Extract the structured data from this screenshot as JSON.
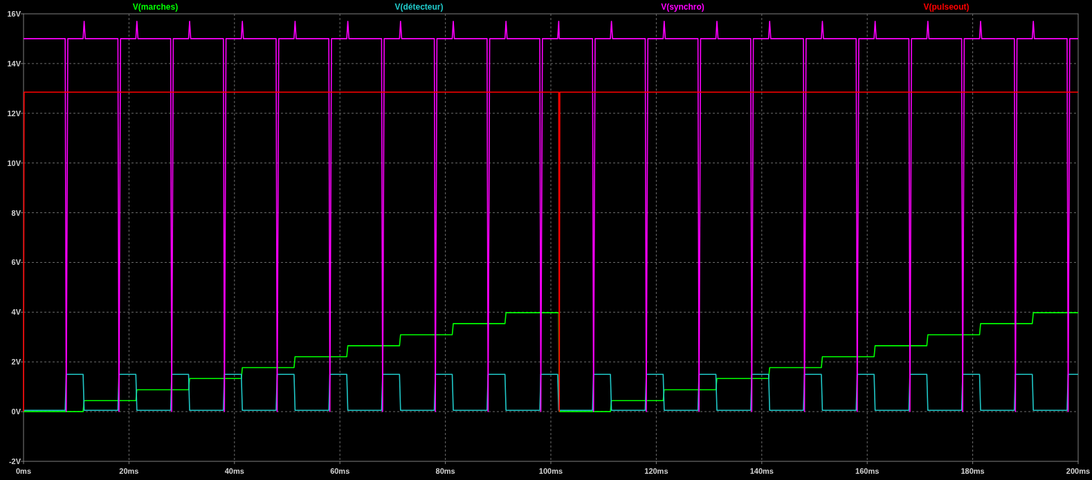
{
  "plot": {
    "chart_data": {
      "type": "line",
      "grid": true,
      "x": [
        0,
        0.1,
        1.3,
        1.5,
        1.7,
        7.9,
        8.1,
        8.4,
        10,
        11.3,
        11.5,
        11.7,
        17.9,
        18.1,
        18.4,
        20,
        21.3,
        21.5,
        21.7,
        27.9,
        28.1,
        28.4,
        30,
        31.3,
        31.5,
        31.7,
        37.9,
        38.1,
        38.4,
        40,
        41.3,
        41.5,
        41.7,
        47.9,
        48.1,
        48.4,
        50,
        51.3,
        51.5,
        51.7,
        57.9,
        58.1,
        58.4,
        60,
        61.3,
        61.5,
        61.7,
        67.9,
        68.1,
        68.4,
        70,
        71.3,
        71.5,
        71.7,
        77.9,
        78.1,
        78.4,
        80,
        81.3,
        81.5,
        81.7,
        87.9,
        88.1,
        88.4,
        90,
        91.3,
        91.5,
        91.7,
        97.9,
        98.1,
        98.4,
        100,
        101.3,
        101.5,
        101.6,
        101.7,
        107.9,
        108.1,
        108.4,
        110,
        111.3,
        111.5,
        111.7,
        117.9,
        118.1,
        118.4,
        120,
        121.3,
        121.5,
        121.7,
        127.9,
        128.1,
        128.4,
        130,
        131.3,
        131.5,
        131.7,
        137.9,
        138.1,
        138.4,
        140,
        141.3,
        141.5,
        141.7,
        147.9,
        148.1,
        148.4,
        150,
        151.3,
        151.5,
        151.7,
        157.9,
        158.1,
        158.4,
        160,
        161.3,
        161.5,
        161.7,
        167.9,
        168.1,
        168.4,
        170,
        171.3,
        171.5,
        171.7,
        177.9,
        178.1,
        178.4,
        180,
        181.3,
        181.5,
        181.7,
        187.9,
        188.1,
        188.4,
        190,
        191.3,
        191.5,
        191.7,
        197.9,
        198.1,
        198.4,
        200
      ],
      "series": [
        {
          "name": "V(marches)",
          "color": "#00ff00",
          "values": [
            0,
            0,
            0,
            0,
            0,
            0,
            0,
            0,
            0,
            0,
            0.44,
            0.44,
            0.44,
            0.44,
            0.44,
            0.44,
            0.44,
            0.88,
            0.88,
            0.88,
            0.88,
            0.88,
            0.88,
            0.88,
            1.33,
            1.33,
            1.33,
            1.33,
            1.33,
            1.33,
            1.33,
            1.77,
            1.77,
            1.77,
            1.77,
            1.77,
            1.77,
            1.77,
            2.21,
            2.21,
            2.21,
            2.21,
            2.21,
            2.21,
            2.21,
            2.65,
            2.65,
            2.65,
            2.65,
            2.65,
            2.65,
            2.65,
            3.09,
            3.09,
            3.09,
            3.09,
            3.09,
            3.09,
            3.09,
            3.54,
            3.54,
            3.54,
            3.54,
            3.54,
            3.54,
            3.54,
            3.98,
            3.98,
            3.98,
            3.98,
            3.98,
            3.98,
            3.98,
            3.98,
            0,
            0,
            0,
            0,
            0,
            0,
            0,
            0.44,
            0.44,
            0.44,
            0.44,
            0.44,
            0.44,
            0.44,
            0.88,
            0.88,
            0.88,
            0.88,
            0.88,
            0.88,
            0.88,
            1.33,
            1.33,
            1.33,
            1.33,
            1.33,
            1.33,
            1.33,
            1.77,
            1.77,
            1.77,
            1.77,
            1.77,
            1.77,
            1.77,
            2.21,
            2.21,
            2.21,
            2.21,
            2.21,
            2.21,
            2.21,
            2.65,
            2.65,
            2.65,
            2.65,
            2.65,
            2.65,
            2.65,
            3.09,
            3.09,
            3.09,
            3.09,
            3.09,
            3.09,
            3.09,
            3.54,
            3.54,
            3.54,
            3.54,
            3.54,
            3.54,
            3.54,
            3.98,
            3.98,
            3.98,
            3.98,
            3.98,
            3.98
          ]
        },
        {
          "name": "V(détecteur)",
          "color": "#20c8c8",
          "values": [
            0.05,
            0.05,
            0.05,
            0.05,
            0.05,
            0.05,
            1.5,
            1.5,
            1.5,
            1.5,
            0.05,
            0.05,
            0.05,
            1.5,
            1.5,
            1.5,
            1.5,
            0.05,
            0.05,
            0.05,
            1.5,
            1.5,
            1.5,
            1.5,
            0.05,
            0.05,
            0.05,
            1.5,
            1.5,
            1.5,
            1.5,
            0.05,
            0.05,
            0.05,
            1.5,
            1.5,
            1.5,
            1.5,
            0.05,
            0.05,
            0.05,
            1.5,
            1.5,
            1.5,
            1.5,
            0.05,
            0.05,
            0.05,
            1.5,
            1.5,
            1.5,
            1.5,
            0.05,
            0.05,
            0.05,
            1.5,
            1.5,
            1.5,
            1.5,
            0.05,
            0.05,
            0.05,
            1.5,
            1.5,
            1.5,
            1.5,
            0.05,
            0.05,
            0.05,
            1.5,
            1.5,
            1.5,
            1.5,
            0.05,
            0.05,
            0.05,
            0.05,
            1.5,
            1.5,
            1.5,
            1.5,
            0.05,
            0.05,
            0.05,
            1.5,
            1.5,
            1.5,
            1.5,
            0.05,
            0.05,
            0.05,
            1.5,
            1.5,
            1.5,
            1.5,
            0.05,
            0.05,
            0.05,
            1.5,
            1.5,
            1.5,
            1.5,
            0.05,
            0.05,
            0.05,
            1.5,
            1.5,
            1.5,
            1.5,
            0.05,
            0.05,
            0.05,
            1.5,
            1.5,
            1.5,
            1.5,
            0.05,
            0.05,
            0.05,
            1.5,
            1.5,
            1.5,
            1.5,
            0.05,
            0.05,
            0.05,
            1.5,
            1.5,
            1.5,
            1.5,
            0.05,
            0.05,
            0.05,
            1.5,
            1.5,
            1.5,
            1.5,
            0.05,
            0.05,
            0.05,
            1.5,
            1.5,
            1.5
          ]
        },
        {
          "name": "V(synchro)",
          "color": "#ff00ff",
          "values": [
            15,
            15,
            15,
            15,
            15,
            15,
            0,
            15,
            15,
            15,
            15.7,
            15,
            15,
            0,
            15,
            15,
            15,
            15.7,
            15,
            15,
            0,
            15,
            15,
            15,
            15.7,
            15,
            15,
            0,
            15,
            15,
            15,
            15.7,
            15,
            15,
            0,
            15,
            15,
            15,
            15.7,
            15,
            15,
            0,
            15,
            15,
            15,
            15.7,
            15,
            15,
            0,
            15,
            15,
            15,
            15.7,
            15,
            15,
            0,
            15,
            15,
            15,
            15.7,
            15,
            15,
            0,
            15,
            15,
            15,
            15.7,
            15,
            15,
            0,
            15,
            15,
            15,
            15.7,
            15,
            15,
            15,
            0,
            15,
            15,
            15,
            15.7,
            15,
            15,
            0,
            15,
            15,
            15,
            15.7,
            15,
            15,
            0,
            15,
            15,
            15,
            15.7,
            15,
            15,
            0,
            15,
            15,
            15,
            15.7,
            15,
            15,
            0,
            15,
            15,
            15,
            15.7,
            15,
            15,
            0,
            15,
            15,
            15,
            15.7,
            15,
            15,
            0,
            15,
            15,
            15,
            15.7,
            15,
            15,
            0,
            15,
            15,
            15,
            15.7,
            15,
            15,
            0,
            15,
            15,
            15,
            15.7,
            15,
            15,
            0,
            15,
            15
          ]
        },
        {
          "name": "V(pulseout)",
          "color": "#ff0000",
          "values": [
            0,
            12.85,
            12.85,
            12.85,
            12.85,
            12.85,
            12.85,
            12.85,
            12.85,
            12.85,
            12.85,
            12.85,
            12.85,
            12.85,
            12.85,
            12.85,
            12.85,
            12.85,
            12.85,
            12.85,
            12.85,
            12.85,
            12.85,
            12.85,
            12.85,
            12.85,
            12.85,
            12.85,
            12.85,
            12.85,
            12.85,
            12.85,
            12.85,
            12.85,
            12.85,
            12.85,
            12.85,
            12.85,
            12.85,
            12.85,
            12.85,
            12.85,
            12.85,
            12.85,
            12.85,
            12.85,
            12.85,
            12.85,
            12.85,
            12.85,
            12.85,
            12.85,
            12.85,
            12.85,
            12.85,
            12.85,
            12.85,
            12.85,
            12.85,
            12.85,
            12.85,
            12.85,
            12.85,
            12.85,
            12.85,
            12.85,
            12.85,
            12.85,
            12.85,
            12.85,
            12.85,
            12.85,
            12.85,
            12.85,
            0,
            12.85,
            12.85,
            12.85,
            12.85,
            12.85,
            12.85,
            12.85,
            12.85,
            12.85,
            12.85,
            12.85,
            12.85,
            12.85,
            12.85,
            12.85,
            12.85,
            12.85,
            12.85,
            12.85,
            12.85,
            12.85,
            12.85,
            12.85,
            12.85,
            12.85,
            12.85,
            12.85,
            12.85,
            12.85,
            12.85,
            12.85,
            12.85,
            12.85,
            12.85,
            12.85,
            12.85,
            12.85,
            12.85,
            12.85,
            12.85,
            12.85,
            12.85,
            12.85,
            12.85,
            12.85,
            12.85,
            12.85,
            12.85,
            12.85,
            12.85,
            12.85,
            12.85,
            12.85,
            12.85,
            12.85,
            12.85,
            12.85,
            12.85,
            12.85,
            12.85,
            12.85,
            12.85,
            12.85,
            12.85,
            12.85,
            12.85,
            12.85,
            12.85
          ]
        }
      ],
      "xlim": [
        0,
        200
      ],
      "ylim": [
        -2,
        16
      ],
      "xticks": [
        {
          "value": 0,
          "label": "0ms"
        },
        {
          "value": 20,
          "label": "20ms"
        },
        {
          "value": 40,
          "label": "40ms"
        },
        {
          "value": 60,
          "label": "60ms"
        },
        {
          "value": 80,
          "label": "80ms"
        },
        {
          "value": 100,
          "label": "100ms"
        },
        {
          "value": 120,
          "label": "120ms"
        },
        {
          "value": 140,
          "label": "140ms"
        },
        {
          "value": 160,
          "label": "160ms"
        },
        {
          "value": 180,
          "label": "180ms"
        },
        {
          "value": 200,
          "label": "200ms"
        }
      ],
      "yticks": [
        {
          "value": -2,
          "label": "-2V"
        },
        {
          "value": 0,
          "label": "0V"
        },
        {
          "value": 2,
          "label": "2V"
        },
        {
          "value": 4,
          "label": "4V"
        },
        {
          "value": 6,
          "label": "6V"
        },
        {
          "value": 8,
          "label": "8V"
        },
        {
          "value": 10,
          "label": "10V"
        },
        {
          "value": 12,
          "label": "12V"
        },
        {
          "value": 14,
          "label": "14V"
        },
        {
          "value": 16,
          "label": "16V"
        }
      ]
    }
  }
}
